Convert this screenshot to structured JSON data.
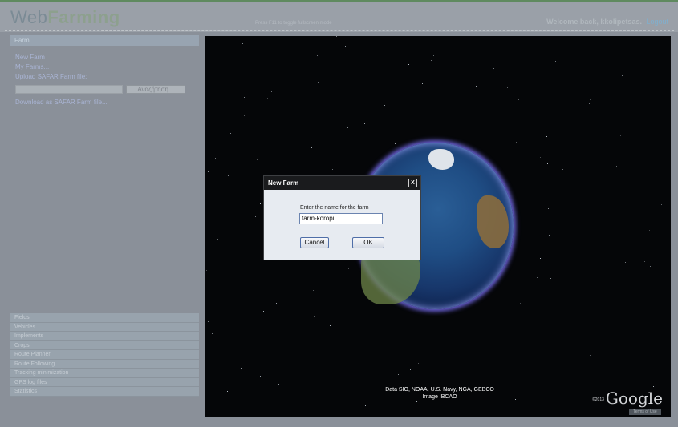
{
  "app": {
    "logo_web": "Web",
    "logo_farming": "Farming",
    "fullscreen_hint": "Press F11 to toggle fullscreen mode",
    "welcome": "Welcome back, kkolipetsas.",
    "logout": "Logout"
  },
  "sidebar": {
    "header": "Farm",
    "items": [
      "New Farm",
      "My Farms...",
      "Upload SAFAR Farm file:"
    ],
    "browse_label": "Αναζήτηση...",
    "download": "Download as SAFAR Farm file...",
    "categories": [
      "Fields",
      "Vehicles",
      "Implements",
      "Crops",
      "Route Planner",
      "Route Following",
      "Tracking minimization",
      "GPS log files",
      "Statistics"
    ]
  },
  "map": {
    "credit_line1": "Data SIO, NOAA, U.S. Navy, NGA, GEBCO",
    "credit_line2": "Image IBCAO",
    "google_year": "©2013",
    "google_label": "Google",
    "terms": "Terms of Use"
  },
  "dialog": {
    "title": "New Farm",
    "close": "X",
    "prompt": "Enter the name for the farm",
    "name_value": "farm-koropi",
    "cancel": "Cancel",
    "ok": "OK"
  }
}
